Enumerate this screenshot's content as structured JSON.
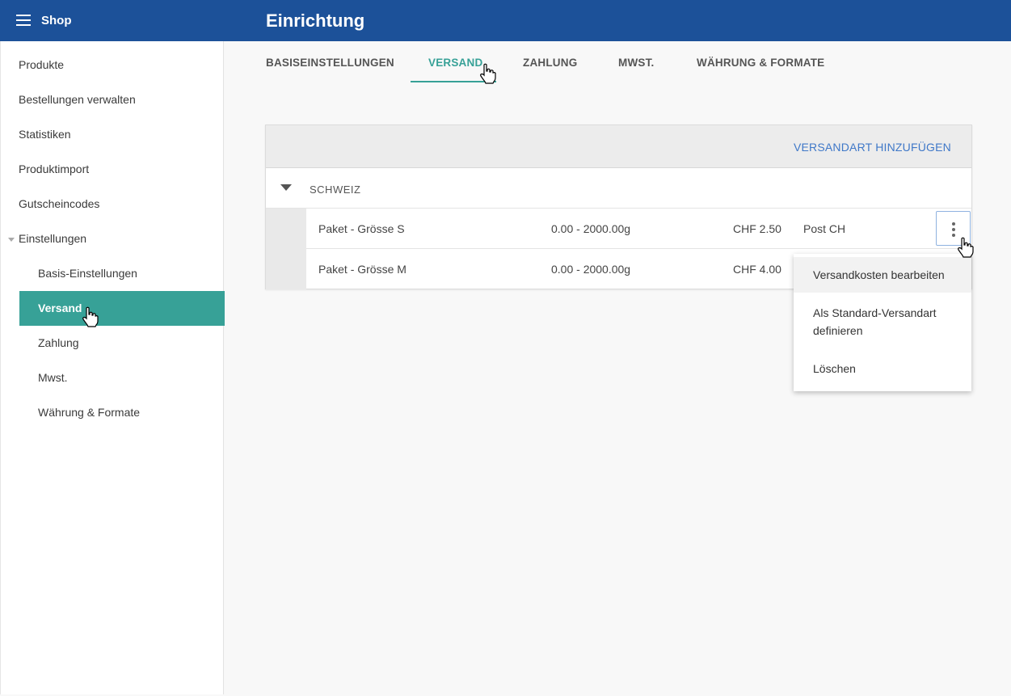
{
  "header": {
    "app_title": "Shop",
    "page_title": "Einrichtung"
  },
  "sidebar": {
    "items": [
      {
        "label": "Produkte"
      },
      {
        "label": "Bestellungen verwalten"
      },
      {
        "label": "Statistiken"
      },
      {
        "label": "Produktimport"
      },
      {
        "label": "Gutscheincodes"
      },
      {
        "label": "Einstellungen"
      }
    ],
    "sub_items": [
      {
        "label": "Basis-Einstellungen"
      },
      {
        "label": "Versand"
      },
      {
        "label": "Zahlung"
      },
      {
        "label": "Mwst."
      },
      {
        "label": "Währung & Formate"
      }
    ]
  },
  "tabs": [
    {
      "label": "BASISEINSTELLUNGEN"
    },
    {
      "label": "VERSAND"
    },
    {
      "label": "ZAHLUNG"
    },
    {
      "label": "MWST."
    },
    {
      "label": "WÄHRUNG & FORMATE"
    }
  ],
  "card": {
    "add_label": "VERSANDART HINZUFÜGEN",
    "group_label": "SCHWEIZ",
    "rows": [
      {
        "name": "Paket - Grösse S",
        "range": "0.00 - 2000.00g",
        "price": "CHF 2.50",
        "carrier": "Post CH"
      },
      {
        "name": "Paket - Grösse M",
        "range": "0.00 - 2000.00g",
        "price": "CHF 4.00",
        "carrier": ""
      }
    ]
  },
  "context_menu": {
    "items": [
      {
        "label": "Versandkosten bearbeiten"
      },
      {
        "label": "Als Standard-Versandart definieren"
      },
      {
        "label": "Löschen"
      }
    ]
  },
  "colors": {
    "header_bg": "#1c5199",
    "accent": "#37a197",
    "link": "#3f78c8"
  }
}
